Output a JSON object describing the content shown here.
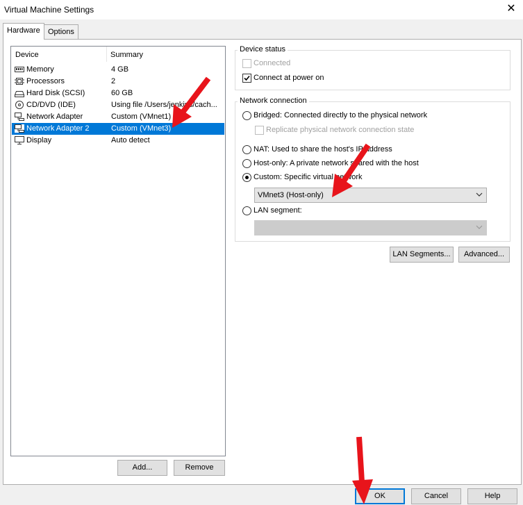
{
  "window": {
    "title": "Virtual Machine Settings",
    "close_glyph": "✕"
  },
  "tabs": [
    {
      "label": "Hardware",
      "selected": true
    },
    {
      "label": "Options",
      "selected": false
    }
  ],
  "device_list": {
    "columns": [
      "Device",
      "Summary"
    ],
    "rows": [
      {
        "device": "Memory",
        "summary": "4 GB",
        "icon": "memory-icon",
        "selected": false
      },
      {
        "device": "Processors",
        "summary": "2",
        "icon": "processor-icon",
        "selected": false
      },
      {
        "device": "Hard Disk (SCSI)",
        "summary": "60 GB",
        "icon": "hard-disk-icon",
        "selected": false
      },
      {
        "device": "CD/DVD (IDE)",
        "summary": "Using file /Users/jenkins/cach...",
        "icon": "cd-dvd-icon",
        "selected": false
      },
      {
        "device": "Network Adapter",
        "summary": "Custom (VMnet1)",
        "icon": "network-adapter-icon",
        "selected": false
      },
      {
        "device": "Network Adapter 2",
        "summary": "Custom (VMnet3)",
        "icon": "network-adapter-icon",
        "selected": true
      },
      {
        "device": "Display",
        "summary": "Auto detect",
        "icon": "display-icon",
        "selected": false
      }
    ]
  },
  "list_buttons": {
    "add": "Add...",
    "remove": "Remove"
  },
  "device_status": {
    "title": "Device status",
    "connected": {
      "label": "Connected",
      "checked": false,
      "enabled": false
    },
    "connect_at_power_on": {
      "label": "Connect at power on",
      "checked": true,
      "enabled": true
    }
  },
  "network_connection": {
    "title": "Network connection",
    "bridged": "Bridged: Connected directly to the physical network",
    "replicate": "Replicate physical network connection state",
    "nat": "NAT: Used to share the host's IP address",
    "host_only": "Host-only: A private network shared with the host",
    "custom": "Custom: Specific virtual network",
    "custom_value": "VMnet3 (Host-only)",
    "lan_segment": "LAN segment:",
    "lan_segment_value": "",
    "selected": "custom"
  },
  "side_buttons": {
    "lan_segments": "LAN Segments...",
    "advanced": "Advanced..."
  },
  "footer_buttons": {
    "ok": "OK",
    "cancel": "Cancel",
    "help": "Help"
  },
  "colors": {
    "selection": "#0078d7",
    "annotation_arrow": "#e8141b"
  }
}
